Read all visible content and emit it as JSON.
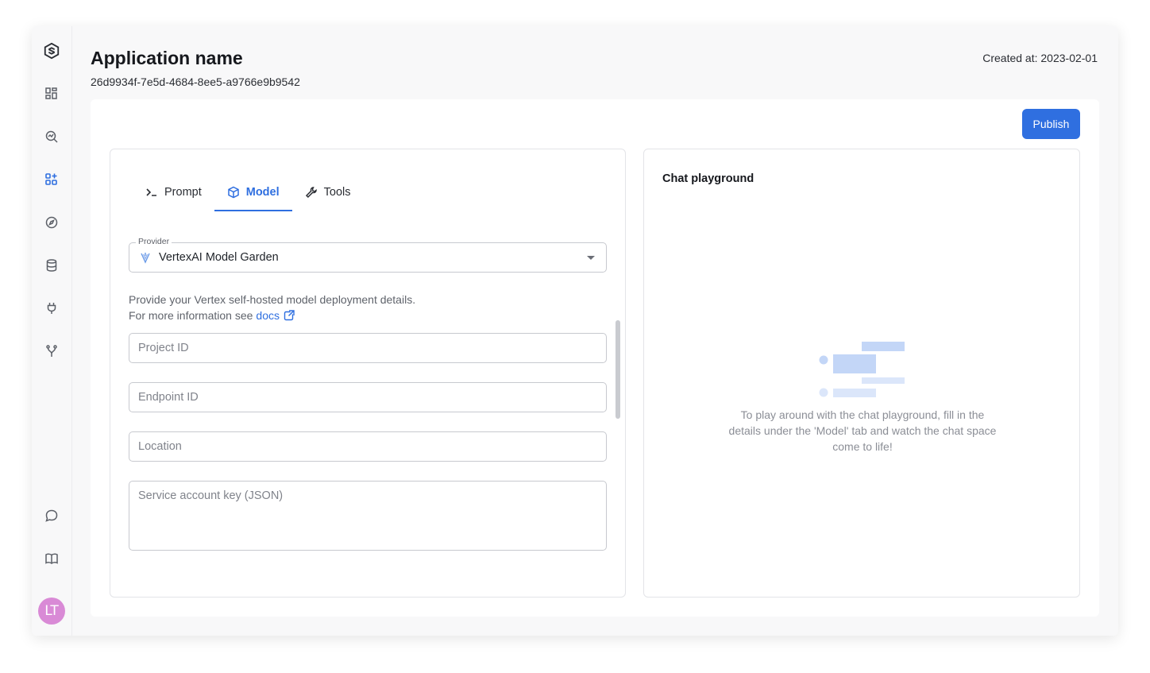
{
  "app": {
    "title": "Application name",
    "id": "26d9934f-7e5d-4684-8ee5-a9766e9b9542",
    "created": "Created at: 2023-02-01"
  },
  "sidebar": {
    "items": [
      {
        "icon": "logo-icon"
      },
      {
        "icon": "dashboard-icon"
      },
      {
        "icon": "search-analytics-icon"
      },
      {
        "icon": "apps-add-icon",
        "active": true
      },
      {
        "icon": "compass-icon"
      },
      {
        "icon": "database-icon"
      },
      {
        "icon": "plug-icon"
      },
      {
        "icon": "branch-icon"
      },
      {
        "icon": "chat-bubble-icon"
      },
      {
        "icon": "book-icon"
      }
    ],
    "avatar": {
      "initials": "LT",
      "color": "#d98ad6"
    }
  },
  "toolbar": {
    "publish_label": "Publish"
  },
  "tabs": [
    {
      "label": "Prompt",
      "icon": "terminal-icon"
    },
    {
      "label": "Model",
      "icon": "cube-icon",
      "active": true
    },
    {
      "label": "Tools",
      "icon": "wrench-icon"
    }
  ],
  "model": {
    "provider_label": "Provider",
    "provider_value": "VertexAI Model Garden",
    "help_line1": "Provide your Vertex self-hosted model deployment details.",
    "help_line2_prefix": "For more information see",
    "docs_label": "docs",
    "fields": {
      "project_id": "Project ID",
      "endpoint_id": "Endpoint ID",
      "location": "Location",
      "service_account": "Service account key (JSON)"
    }
  },
  "chat": {
    "title": "Chat playground",
    "empty_message": "To play around with the chat playground, fill in the details under the 'Model' tab and watch the chat space come to life!"
  },
  "colors": {
    "accent": "#2f6fe0",
    "icon": "#5b5f67"
  }
}
